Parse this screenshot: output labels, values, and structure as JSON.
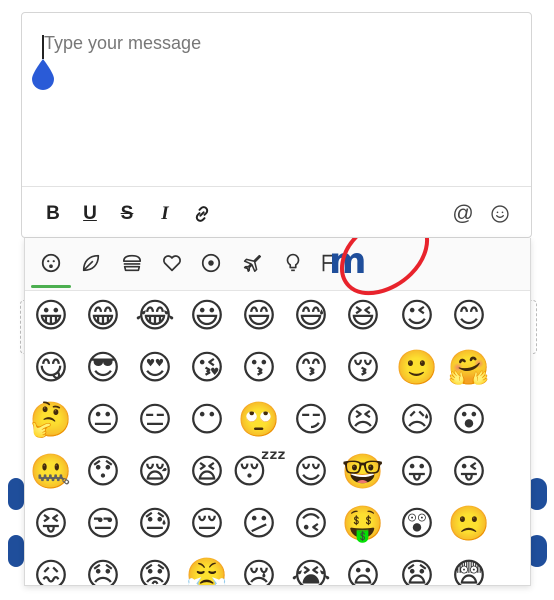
{
  "composer": {
    "placeholder": "Type your message",
    "toolbar": {
      "bold": "B",
      "underline": "U",
      "strike": "S",
      "italic": "I",
      "mention": "@"
    }
  },
  "picker": {
    "categories": [
      {
        "name": "smileys",
        "icon": "smiley-face-icon"
      },
      {
        "name": "nature",
        "icon": "leaf-icon"
      },
      {
        "name": "food",
        "icon": "burger-icon"
      },
      {
        "name": "symbols",
        "icon": "heart-icon"
      },
      {
        "name": "activity",
        "icon": "ball-icon"
      },
      {
        "name": "travel",
        "icon": "airplane-icon"
      },
      {
        "name": "objects",
        "icon": "lightbulb-icon"
      },
      {
        "name": "flags",
        "icon": "flag-icon"
      }
    ],
    "custom_label": "m",
    "active_color": "#4caf50",
    "brand_color": "#1f4e9b",
    "annotation_color": "#e8232c",
    "emoji_rows": [
      [
        "😀",
        "😁",
        "😂",
        "😃",
        "😄",
        "😅",
        "😆",
        "😉",
        "😊"
      ],
      [
        "😋",
        "😎",
        "😍",
        "😘",
        "😗",
        "😙",
        "😚",
        "🙂",
        "🤗"
      ],
      [
        "🤔",
        "😐",
        "😑",
        "😶",
        "🙄",
        "😏",
        "😣",
        "😥",
        "😮"
      ],
      [
        "🤐",
        "😯",
        "😪",
        "😫",
        "😴",
        "😌",
        "🤓",
        "😛",
        "😜"
      ],
      [
        "😝",
        "😒",
        "😓",
        "😔",
        "😕",
        "🙃",
        "🤑",
        "😲",
        "🙁"
      ],
      [
        "😖",
        "😞",
        "😟",
        "😤",
        "😢",
        "😭",
        "😦",
        "😧",
        "😨"
      ]
    ]
  }
}
